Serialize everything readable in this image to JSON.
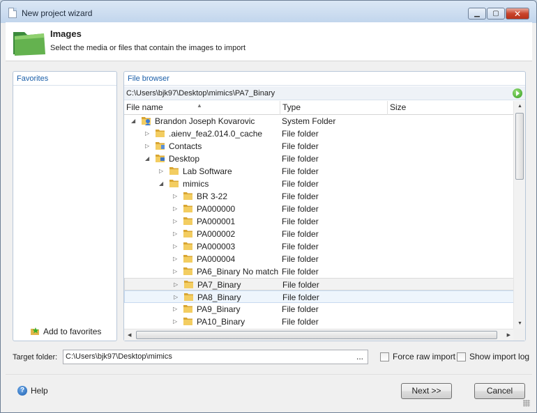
{
  "window": {
    "title": "New project wizard"
  },
  "header": {
    "title": "Images",
    "subtitle": "Select the media or files that contain the images to import"
  },
  "favorites": {
    "title": "Favorites",
    "add_label": "Add to favorites"
  },
  "file_browser": {
    "title": "File browser",
    "path": "C:\\Users\\bjk97\\Desktop\\mimics\\PA7_Binary",
    "columns": [
      "File name",
      "Type",
      "Size"
    ],
    "rows": [
      {
        "name": "Brandon Joseph Kovarovic",
        "type": "System Folder",
        "level": 0,
        "expanded": true,
        "icon": "user-folder-icon"
      },
      {
        "name": ".aienv_fea2.014.0_cache",
        "type": "File folder",
        "level": 1,
        "expanded": false,
        "icon": "folder-icon"
      },
      {
        "name": "Contacts",
        "type": "File folder",
        "level": 1,
        "expanded": false,
        "icon": "contacts-folder-icon"
      },
      {
        "name": "Desktop",
        "type": "File folder",
        "level": 1,
        "expanded": true,
        "icon": "desktop-folder-icon"
      },
      {
        "name": "Lab Software",
        "type": "File folder",
        "level": 2,
        "expanded": false,
        "icon": "folder-icon"
      },
      {
        "name": "mimics",
        "type": "File folder",
        "level": 2,
        "expanded": true,
        "icon": "folder-icon"
      },
      {
        "name": "BR 3-22",
        "type": "File folder",
        "level": 3,
        "expanded": false,
        "icon": "folder-icon"
      },
      {
        "name": "PA000000",
        "type": "File folder",
        "level": 3,
        "expanded": false,
        "icon": "folder-icon"
      },
      {
        "name": "PA000001",
        "type": "File folder",
        "level": 3,
        "expanded": false,
        "icon": "folder-icon"
      },
      {
        "name": "PA000002",
        "type": "File folder",
        "level": 3,
        "expanded": false,
        "icon": "folder-icon"
      },
      {
        "name": "PA000003",
        "type": "File folder",
        "level": 3,
        "expanded": false,
        "icon": "folder-icon"
      },
      {
        "name": "PA000004",
        "type": "File folder",
        "level": 3,
        "expanded": false,
        "icon": "folder-icon"
      },
      {
        "name": "PA6_Binary No match",
        "type": "File folder",
        "level": 3,
        "expanded": false,
        "icon": "folder-icon"
      },
      {
        "name": "PA7_Binary",
        "type": "File folder",
        "level": 3,
        "expanded": false,
        "icon": "folder-icon",
        "selected": true
      },
      {
        "name": "PA8_Binary",
        "type": "File folder",
        "level": 3,
        "expanded": false,
        "icon": "folder-icon",
        "hover": true
      },
      {
        "name": "PA9_Binary",
        "type": "File folder",
        "level": 3,
        "expanded": false,
        "icon": "folder-icon"
      },
      {
        "name": "PA10_Binary",
        "type": "File folder",
        "level": 3,
        "expanded": false,
        "icon": "folder-icon"
      }
    ]
  },
  "target": {
    "label": "Target folder:",
    "value": "C:\\Users\\bjk97\\Desktop\\mimics",
    "browse": "..."
  },
  "options": {
    "force_raw_import": {
      "label": "Force raw import",
      "checked": false
    },
    "show_import_log": {
      "label": "Show import log",
      "checked": false
    }
  },
  "footer": {
    "help": "Help",
    "next": "Next >>",
    "cancel": "Cancel"
  }
}
